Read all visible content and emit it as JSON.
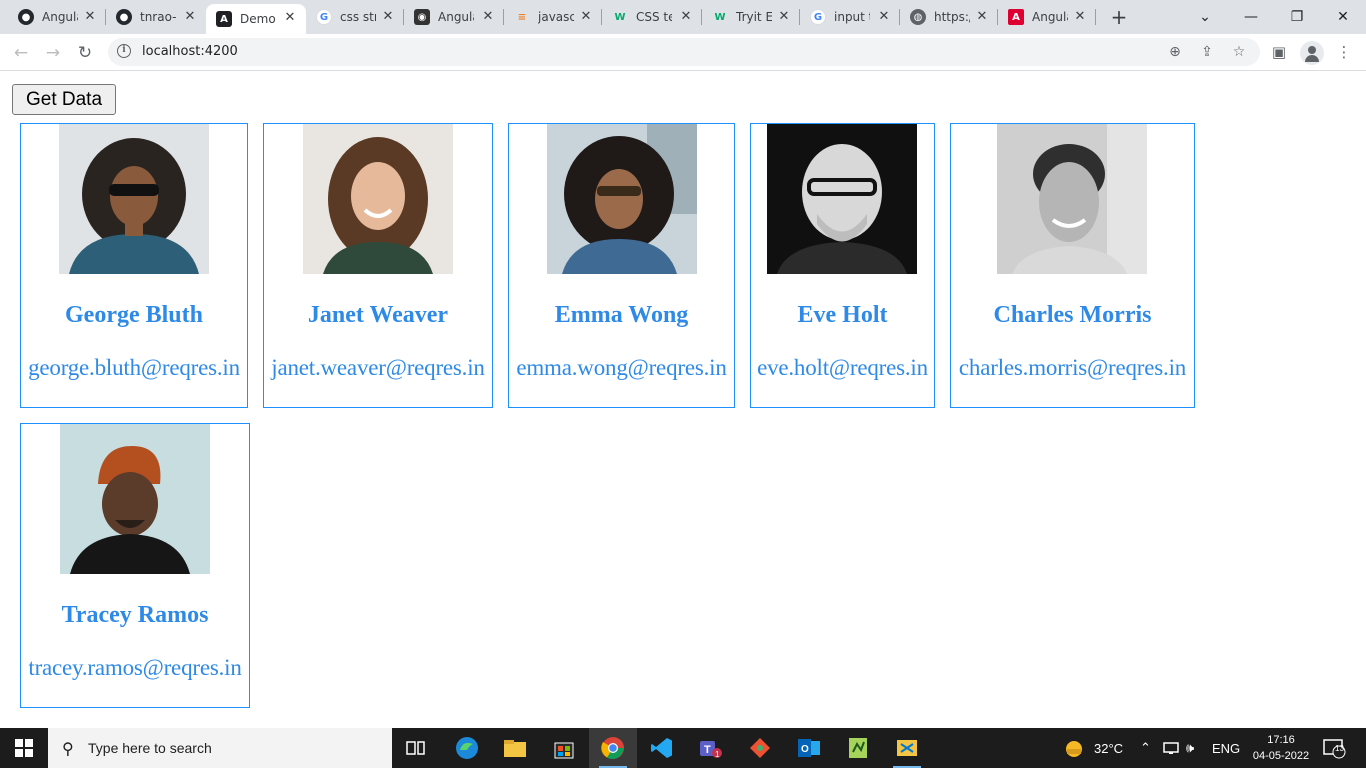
{
  "browser": {
    "tabs": [
      {
        "title": "Angula",
        "icon": "github-icon",
        "active": false
      },
      {
        "title": "tnrao-",
        "icon": "github-icon",
        "active": false
      },
      {
        "title": "Demo",
        "icon": "angular-icon",
        "active": true
      },
      {
        "title": "css stri",
        "icon": "google-icon",
        "active": false
      },
      {
        "title": "Angula",
        "icon": "codegrepper-icon",
        "active": false
      },
      {
        "title": "javascr",
        "icon": "stackoverflow-icon",
        "active": false
      },
      {
        "title": "CSS te",
        "icon": "w3schools-icon",
        "active": false
      },
      {
        "title": "Tryit Ed",
        "icon": "w3schools-icon",
        "active": false
      },
      {
        "title": "input t",
        "icon": "google-icon",
        "active": false
      },
      {
        "title": "https:/",
        "icon": "globe-icon",
        "active": false
      },
      {
        "title": "Angula",
        "icon": "angular-red-icon",
        "active": false
      }
    ],
    "url": "localhost:4200"
  },
  "page": {
    "get_data_label": "Get Data",
    "users": [
      {
        "name": "George Bluth",
        "email": "george.bluth@reqres.in"
      },
      {
        "name": "Janet Weaver",
        "email": "janet.weaver@reqres.in"
      },
      {
        "name": "Emma Wong",
        "email": "emma.wong@reqres.in"
      },
      {
        "name": "Eve Holt",
        "email": "eve.holt@reqres.in"
      },
      {
        "name": "Charles Morris",
        "email": "charles.morris@reqres.in"
      },
      {
        "name": "Tracey Ramos",
        "email": "tracey.ramos@reqres.in"
      }
    ],
    "accent_color": "#2e8ae6"
  },
  "taskbar": {
    "search_placeholder": "Type here to search",
    "temperature": "32°C",
    "language": "ENG",
    "time": "17:16",
    "date": "04-05-2022",
    "notification_count": "13"
  }
}
